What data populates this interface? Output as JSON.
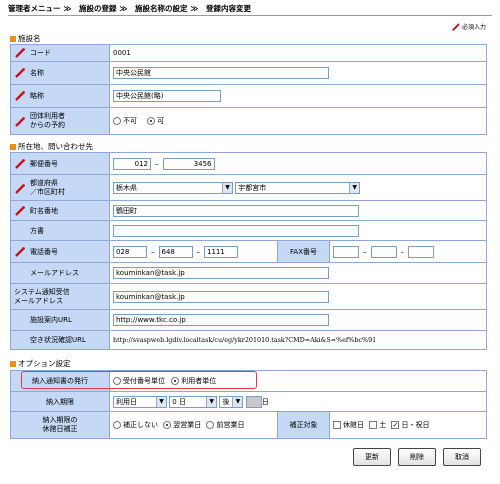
{
  "breadcrumb": [
    "管理者メニュー",
    "施設の登録",
    "施設名称の設定",
    "登録内容変更"
  ],
  "breadcrumb_sep": "≫",
  "required_note": "必須入力",
  "sections": {
    "facility": "施設名",
    "address": "所在地、問い合わせ先",
    "options": "オプション設定"
  },
  "facility": {
    "code_label": "コード",
    "code_value": "0001",
    "name_label": "名称",
    "name_value": "中央公民館",
    "abbr_label": "略称",
    "abbr_value": "中央公民館(略)",
    "group_label_1": "団体利用者",
    "group_label_2": "からの予約",
    "group_opt1": "不可",
    "group_opt2": "可"
  },
  "address": {
    "postal_label": "郵便番号",
    "postal1": "012",
    "postal2": "3456",
    "pref_label_1": "都道府県",
    "pref_label_2": "／市区町村",
    "pref_value": "栃木県",
    "city_value": "宇都宮市",
    "town_label": "町名番地",
    "town_value": "鶴田町",
    "kata_label": "方書",
    "kata_value": "",
    "tel_label": "電話番号",
    "tel1": "028",
    "tel2": "648",
    "tel3": "1111",
    "fax_label": "FAX番号",
    "mail_label": "メールアドレス",
    "mail_value": "kouminkan@task.jp",
    "sysmail_label_1": "システム通知受信",
    "sysmail_label_2": "メールアドレス",
    "sysmail_value": "kouminkan@task.jp",
    "url_label": "施設案内URL",
    "url_value": "http://www.tkc.co.jp",
    "vacancy_label": "空き状況確認URL",
    "vacancy_value": "http://svaspweb.lgdiv.localtask/cu/eg/ykr201010.task?CMD=Aki&S=%ef%bc%91"
  },
  "options": {
    "notice_label": "納入通知書の発行",
    "notice_opt1": "受付番号単位",
    "notice_opt2": "利用者単位",
    "deadline_label": "納入期限",
    "deadline_base": "利用日",
    "deadline_days": "0",
    "deadline_unit": "日",
    "deadline_dir": "後",
    "deadline_suffix": "日",
    "holiday_label_1": "納入期限の",
    "holiday_label_2": "休館日補正",
    "holiday_opt1": "補正しない",
    "holiday_opt2": "翌営業日",
    "holiday_opt3": "前営業日",
    "target_label": "補正対象",
    "target_opt1": "休館日",
    "target_opt2": "土",
    "target_opt3": "日・祝日"
  },
  "buttons": {
    "update": "更新",
    "delete": "削除",
    "cancel": "取消"
  }
}
